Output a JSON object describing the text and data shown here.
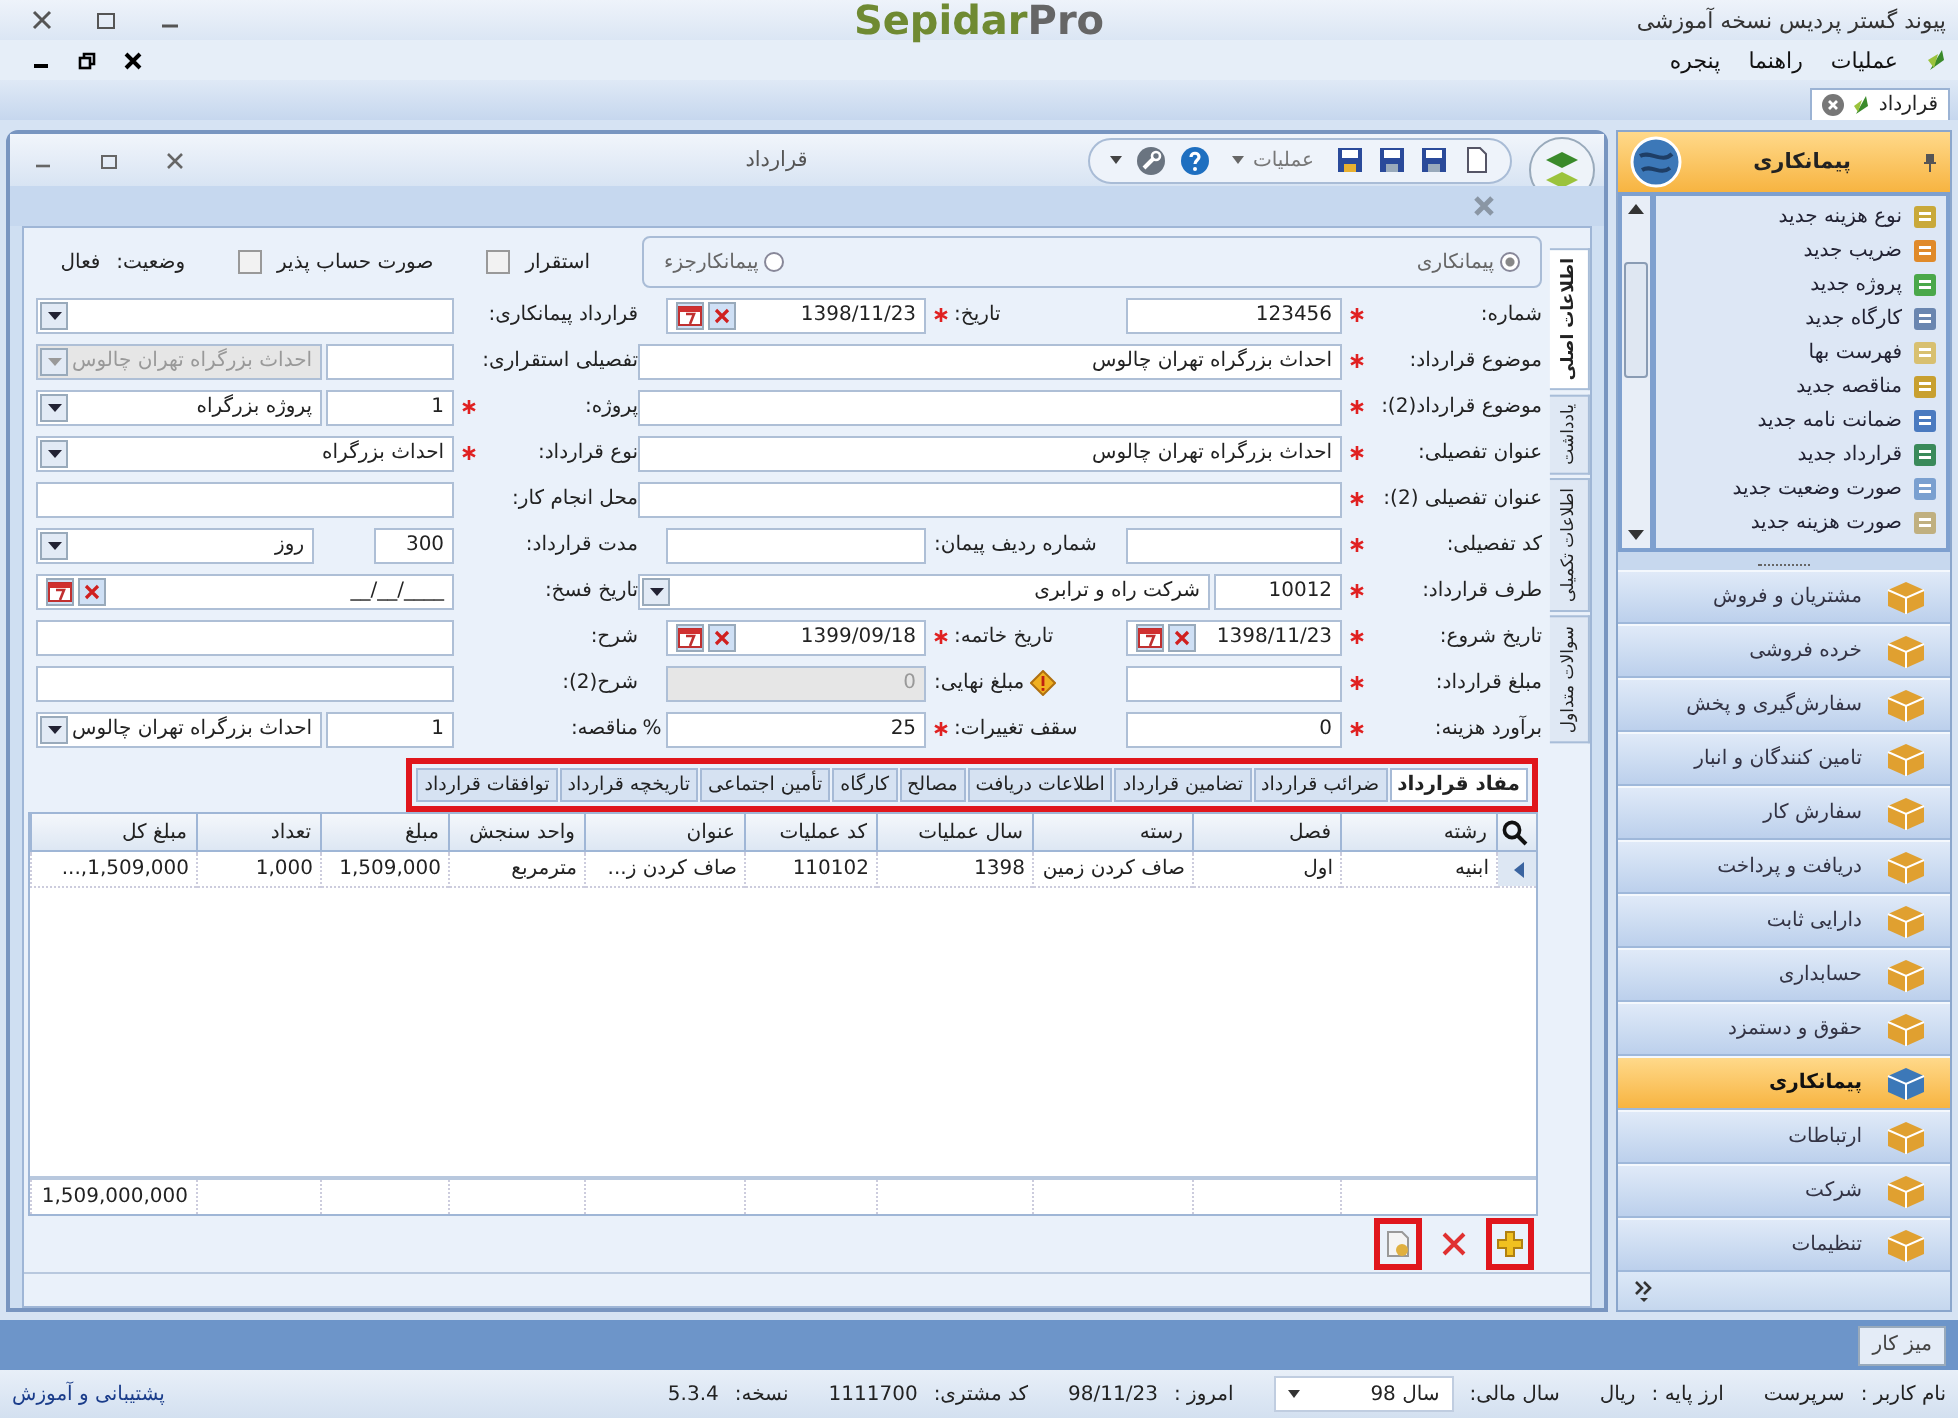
{
  "app": {
    "title": "پیوند گستر پردیس نسخه آموزشی",
    "logo_main": "Sepidar",
    "logo_accent": "Pro"
  },
  "menu": [
    "عملیات",
    "راهنما",
    "پنجره"
  ],
  "doc_tabs": [
    {
      "label": "قرارداد",
      "selected": true
    }
  ],
  "window": {
    "title": "قرارداد",
    "toolbar_menu": "عملیات"
  },
  "contract_type": [
    {
      "label": "پیمانکاری",
      "selected": true
    },
    {
      "label": "پیمانکارجزء",
      "selected": false
    }
  ],
  "options": [
    {
      "label": "استقرار",
      "checked": false
    },
    {
      "label": "صورت حساب پذیر",
      "checked": false
    }
  ],
  "status": {
    "label": "وضعیت:",
    "value": "فعال"
  },
  "side_tabs": [
    {
      "label": "اطلاعات اصلی",
      "selected": true
    },
    {
      "label": "یادداشت",
      "selected": false
    },
    {
      "label": "اطلاعات تکمیلی",
      "selected": false
    },
    {
      "label": "سوالات متداول",
      "selected": false
    }
  ],
  "form_rows": [
    {
      "column_1": {
        "label": "شماره:",
        "required": true,
        "inputs": [
          {
            "kind": "text",
            "value": "123456"
          }
        ]
      },
      "column_2": {
        "label": "تاریخ:",
        "required": true,
        "inputs": [
          {
            "kind": "date",
            "value": "1398/11/23"
          }
        ]
      },
      "column_3": {
        "label": "قرارداد پیمانکاری:",
        "required": false,
        "inputs": [
          {
            "kind": "dropdown"
          }
        ]
      }
    },
    {
      "column_1": {
        "label": "موضوع قرارداد:",
        "required": true,
        "inputs": [
          {
            "kind": "text",
            "value": "احداث بزرگراه تهران چالوس"
          }
        ]
      },
      "column_3": {
        "label": "تفصیلی استقراری:",
        "required": false,
        "inputs": [
          {
            "kind": "code",
            "disabled": false
          },
          {
            "kind": "dropdown",
            "value": "احداث بزرگراه تهران چالوس",
            "disabled": true
          }
        ]
      }
    },
    {
      "column_1": {
        "label": "موضوع قرارداد(2):",
        "required": true,
        "inputs": [
          {
            "kind": "text"
          }
        ]
      },
      "column_3": {
        "label": "پروژه:",
        "required": true,
        "inputs": [
          {
            "kind": "code",
            "value": "1"
          },
          {
            "kind": "dropdown",
            "value": "پروژه بزرگراه"
          }
        ]
      }
    },
    {
      "column_1": {
        "label": "عنوان تفصیلی:",
        "required": true,
        "inputs": [
          {
            "kind": "text",
            "value": "احداث بزرگراه تهران چالوس"
          }
        ]
      },
      "column_3": {
        "label": "نوع قرارداد:",
        "required": true,
        "inputs": [
          {
            "kind": "dropdown",
            "value": "احداث بزرگراه"
          }
        ]
      }
    },
    {
      "column_1": {
        "label": "عنوان تفصیلی (2):",
        "required": true,
        "inputs": [
          {
            "kind": "text"
          }
        ]
      },
      "column_3": {
        "label": "محل انجام کار:",
        "required": false,
        "inputs": [
          {
            "kind": "text"
          }
        ]
      }
    },
    {
      "column_1": {
        "label": "کد تفصیلی:",
        "required": true,
        "inputs": [
          {
            "kind": "text"
          }
        ]
      },
      "column_2": {
        "label": "شماره ردیف پیمان:",
        "required": false,
        "inputs": [
          {
            "kind": "text"
          }
        ]
      },
      "column_3": {
        "label": "مدت قرارداد:",
        "required": false,
        "inputs": [
          {
            "kind": "short",
            "value": "300"
          },
          {
            "kind": "dropdown",
            "value": "روز"
          }
        ]
      }
    },
    {
      "column_1": {
        "label": "طرف قرارداد:",
        "required": true,
        "inputs": [
          {
            "kind": "code",
            "value": "10012"
          },
          {
            "kind": "dropdown",
            "value": "شرکت راه و ترابری"
          }
        ]
      },
      "column_3": {
        "label": "تاریخ فسخ:",
        "required": false,
        "inputs": [
          {
            "kind": "date",
            "value": "__/__/____"
          }
        ]
      }
    },
    {
      "column_1": {
        "label": "تاریخ شروع:",
        "required": true,
        "inputs": [
          {
            "kind": "date",
            "value": "1398/11/23"
          }
        ]
      },
      "column_2": {
        "label": "تاریخ خاتمه:",
        "required": true,
        "inputs": [
          {
            "kind": "date",
            "value": "1399/09/18"
          }
        ]
      },
      "column_3": {
        "label": "شرح:",
        "required": false,
        "inputs": [
          {
            "kind": "text"
          }
        ]
      }
    },
    {
      "column_1": {
        "label": "مبلغ قرارداد:",
        "required": true,
        "inputs": [
          {
            "kind": "text"
          }
        ]
      },
      "column_2": {
        "label": "مبلغ نهایی:",
        "required": false,
        "warning": true,
        "inputs": [
          {
            "kind": "text",
            "value": "0",
            "disabled": true
          }
        ]
      },
      "column_3": {
        "label": "شرح(2):",
        "required": false,
        "inputs": [
          {
            "kind": "text"
          }
        ]
      }
    },
    {
      "column_1": {
        "label": "برآورد هزینه:",
        "required": true,
        "inputs": [
          {
            "kind": "text",
            "value": "0"
          }
        ]
      },
      "column_2": {
        "label": "سقف تغییرات:",
        "required": true,
        "unit": "%",
        "inputs": [
          {
            "kind": "text",
            "value": "25"
          }
        ]
      },
      "column_3": {
        "label": "مناقصه:",
        "required": false,
        "inputs": [
          {
            "kind": "code",
            "value": "1"
          },
          {
            "kind": "dropdown",
            "value": "احداث بزرگراه تهران چالوس"
          }
        ]
      }
    }
  ],
  "detail_tabs": {
    "highlighted": true,
    "tabs": [
      {
        "label": "مفاد قرارداد",
        "selected": true
      },
      {
        "label": "ضرائب قرارداد",
        "selected": false
      },
      {
        "label": "تضامین قرارداد",
        "selected": false
      },
      {
        "label": "اطلاعات دریافت",
        "selected": false
      },
      {
        "label": "مصالح",
        "selected": false
      },
      {
        "label": "کارگاه",
        "selected": false
      },
      {
        "label": "تأمین اجتماعی",
        "selected": false
      },
      {
        "label": "تاریخچه قرارداد",
        "selected": false
      },
      {
        "label": "توافقات قرارداد",
        "selected": false
      }
    ]
  },
  "grid": {
    "columns": [
      "رشته",
      "فصل",
      "رسته",
      "سال عملیات",
      "کد عملیات",
      "عنوان",
      "واحد سنجش",
      "مبلغ",
      "تعداد",
      "مبلغ کل"
    ],
    "rows": [
      {
        "selected": true,
        "cells": [
          "ابنیه",
          "اول",
          "صاف کردن زمین",
          "1398",
          "110102",
          "صاف کردن ز...",
          "مترمربع",
          "1,509,000",
          "1,000",
          "1,509,000,..."
        ]
      }
    ],
    "total": "1,509,000,000"
  },
  "grid_buttons": [
    {
      "kind": "add",
      "highlighted": true
    },
    {
      "kind": "delete",
      "highlighted": false
    },
    {
      "kind": "attach",
      "highlighted": true
    }
  ],
  "sidebar": {
    "title": "پیمانکاری",
    "items": [
      "نوع هزینه جدید",
      "ضریب جدید",
      "پروژه جدید",
      "کارگاه جدید",
      "فهرست بها",
      "مناقصه جدید",
      "ضمانت نامه جدید",
      "قرارداد جدید",
      "صورت وضعیت جدید",
      "صورت هزینه جدید"
    ],
    "modules": [
      {
        "label": "مشتریان و فروش",
        "selected": false
      },
      {
        "label": "خرده فروشی",
        "selected": false
      },
      {
        "label": "سفارش‌گیری و پخش",
        "selected": false
      },
      {
        "label": "تامین کنندگان و انبار",
        "selected": false
      },
      {
        "label": "سفارش کار",
        "selected": false
      },
      {
        "label": "دریافت و پرداخت",
        "selected": false
      },
      {
        "label": "دارایی ثابت",
        "selected": false
      },
      {
        "label": "حسابداری",
        "selected": false
      },
      {
        "label": "حقوق و دستمزد",
        "selected": false
      },
      {
        "label": "پیمانکاری",
        "selected": true
      },
      {
        "label": "ارتباطات",
        "selected": false
      },
      {
        "label": "شرکت",
        "selected": false
      },
      {
        "label": "تنظیمات",
        "selected": false
      }
    ]
  },
  "taskbar": [
    "میز کار"
  ],
  "status_bar": {
    "fields": [
      {
        "kind": "text",
        "label": "نام کاربر :",
        "value": "سرپرست"
      },
      {
        "kind": "text",
        "label": "ارز پایه :",
        "value": "ریال"
      },
      {
        "kind": "dropdown",
        "label": "سال مالی:",
        "value": "سال 98"
      },
      {
        "kind": "text",
        "label": "امروز :",
        "value": "98/11/23"
      },
      {
        "kind": "text",
        "label": "کد مشتری:",
        "value": "1111700"
      },
      {
        "kind": "text",
        "label": "نسخه:",
        "value": "5.3.4"
      }
    ],
    "support": "پشتیبانی و آموزش"
  }
}
